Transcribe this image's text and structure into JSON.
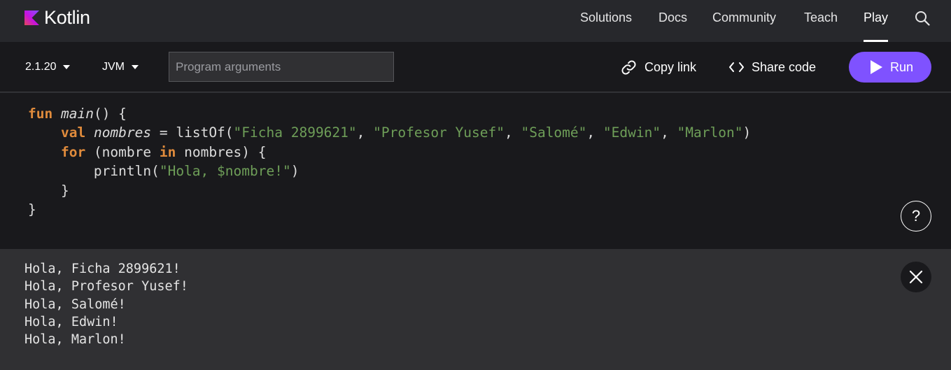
{
  "header": {
    "logo_text": "Kotlin",
    "nav": [
      "Solutions",
      "Docs",
      "Community",
      "Teach",
      "Play"
    ],
    "active_nav": "Play",
    "search_icon": "search-icon"
  },
  "toolbar": {
    "version": "2.1.20",
    "target": "JVM",
    "args_placeholder": "Program arguments",
    "copy_link": "Copy link",
    "share_code": "Share code",
    "run": "Run"
  },
  "editor": {
    "lines": [
      [
        {
          "t": "fun",
          "c": "kw"
        },
        {
          "t": " "
        },
        {
          "t": "main",
          "c": "it"
        },
        {
          "t": "() {"
        }
      ],
      [
        {
          "t": "    "
        },
        {
          "t": "val",
          "c": "kw"
        },
        {
          "t": " "
        },
        {
          "t": "nombres",
          "c": "it"
        },
        {
          "t": " = listOf("
        },
        {
          "t": "\"Ficha 2899621\"",
          "c": "str"
        },
        {
          "t": ", "
        },
        {
          "t": "\"Profesor Yusef\"",
          "c": "str"
        },
        {
          "t": ", "
        },
        {
          "t": "\"Salomé\"",
          "c": "str"
        },
        {
          "t": ", "
        },
        {
          "t": "\"Edwin\"",
          "c": "str"
        },
        {
          "t": ", "
        },
        {
          "t": "\"Marlon\"",
          "c": "str"
        },
        {
          "t": ")"
        }
      ],
      [
        {
          "t": "    "
        },
        {
          "t": "for",
          "c": "kw"
        },
        {
          "t": " (nombre "
        },
        {
          "t": "in",
          "c": "kw"
        },
        {
          "t": " nombres) {"
        }
      ],
      [
        {
          "t": "        println("
        },
        {
          "t": "\"Hola, $nombre!\"",
          "c": "str"
        },
        {
          "t": ")"
        }
      ],
      [
        {
          "t": "    }"
        }
      ],
      [
        {
          "t": "}"
        }
      ]
    ],
    "help": "?"
  },
  "output": {
    "lines": [
      "Hola, Ficha 2899621!",
      "Hola, Profesor Yusef!",
      "Hola, Salomé!",
      "Hola, Edwin!",
      "Hola, Marlon!"
    ]
  },
  "colors": {
    "brand_purple": "#7f52ff",
    "keyword": "#e08b3c",
    "string": "#6e9e58"
  }
}
